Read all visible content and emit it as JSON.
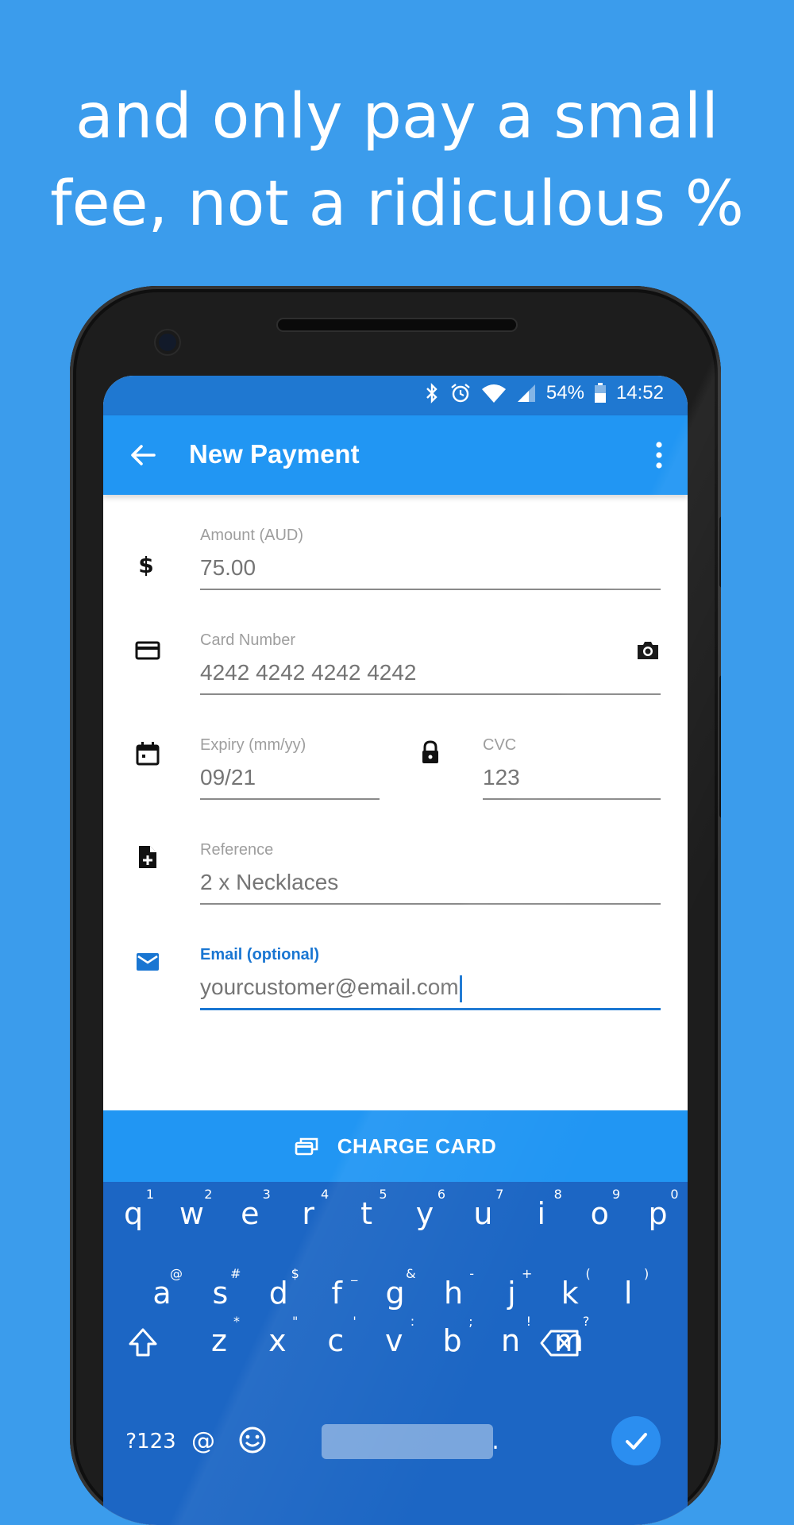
{
  "headline": {
    "line1": "and only pay a small",
    "line2": "fee, not a ridiculous %"
  },
  "statusbar": {
    "battery": "54%",
    "time": "14:52"
  },
  "appbar": {
    "title": "New Payment",
    "icons": [
      "back-arrow-icon",
      "more-vert-icon"
    ]
  },
  "form": {
    "amount": {
      "label": "Amount (AUD)",
      "value": "75.00",
      "icon": "dollar-icon"
    },
    "card": {
      "label": "Card Number",
      "value": "4242 4242 4242 4242",
      "icon": "credit-card-icon",
      "action_icon": "camera-icon"
    },
    "expiry": {
      "label": "Expiry (mm/yy)",
      "value": "09/21",
      "icon": "calendar-icon"
    },
    "cvc": {
      "label": "CVC",
      "value": "123",
      "icon": "lock-icon"
    },
    "reference": {
      "label": "Reference",
      "value": "2 x Necklaces",
      "icon": "note-add-icon"
    },
    "email": {
      "label": "Email (optional)",
      "value": "yourcustomer@email.com",
      "icon": "mail-icon"
    }
  },
  "charge_button": {
    "label": "CHARGE CARD",
    "icon": "payment-cards-icon"
  },
  "keyboard": {
    "row1": [
      {
        "k": "q",
        "s": "1"
      },
      {
        "k": "w",
        "s": "2"
      },
      {
        "k": "e",
        "s": "3"
      },
      {
        "k": "r",
        "s": "4"
      },
      {
        "k": "t",
        "s": "5"
      },
      {
        "k": "y",
        "s": "6"
      },
      {
        "k": "u",
        "s": "7"
      },
      {
        "k": "i",
        "s": "8"
      },
      {
        "k": "o",
        "s": "9"
      },
      {
        "k": "p",
        "s": "0"
      }
    ],
    "row2": [
      {
        "k": "a",
        "s": "@"
      },
      {
        "k": "s",
        "s": "#"
      },
      {
        "k": "d",
        "s": "$"
      },
      {
        "k": "f",
        "s": "_"
      },
      {
        "k": "g",
        "s": "&"
      },
      {
        "k": "h",
        "s": "-"
      },
      {
        "k": "j",
        "s": "+"
      },
      {
        "k": "k",
        "s": "("
      },
      {
        "k": "l",
        "s": ")"
      }
    ],
    "row3": [
      {
        "k": "z",
        "s": "*"
      },
      {
        "k": "x",
        "s": "\""
      },
      {
        "k": "c",
        "s": "'"
      },
      {
        "k": "v",
        "s": ":"
      },
      {
        "k": "b",
        "s": ";"
      },
      {
        "k": "n",
        "s": "!"
      },
      {
        "k": "m",
        "s": "?"
      }
    ],
    "symbols_key": "?123",
    "at_key": "@",
    "period_key": ".",
    "colors": {
      "keyboard_bg": "#1c66c4",
      "accent": "#2196f3"
    }
  }
}
